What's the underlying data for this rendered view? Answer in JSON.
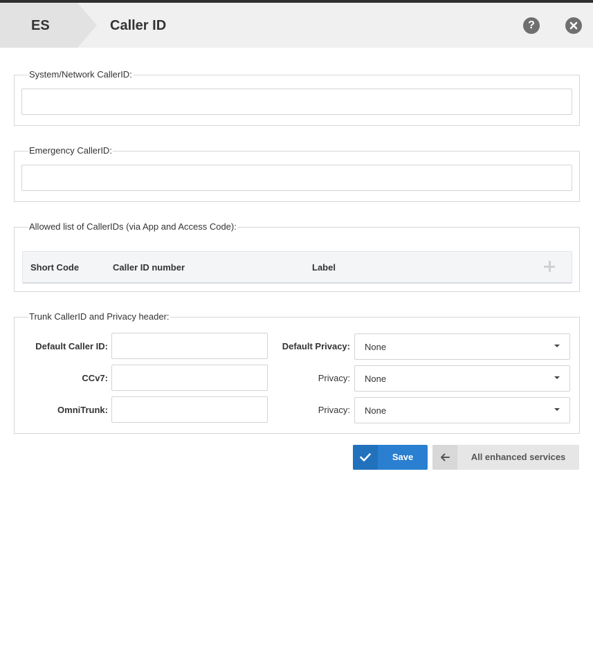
{
  "header": {
    "breadcrumb": "ES",
    "title": "Caller ID"
  },
  "sections": {
    "system_network": {
      "legend": "System/Network CallerID:",
      "value": "",
      "placeholder": ""
    },
    "emergency": {
      "legend": "Emergency CallerID:",
      "value": "",
      "placeholder": ""
    },
    "allowed_list": {
      "legend": "Allowed list of CallerIDs (via App and Access Code):",
      "columns": [
        "Short Code",
        "Caller ID number",
        "Label"
      ],
      "rows": []
    },
    "trunk": {
      "legend": "Trunk CallerID and Privacy header:",
      "rows": [
        {
          "label": "Default Caller ID:",
          "value": "",
          "privacy_label": "Default Privacy:",
          "privacy_value": "None"
        },
        {
          "label": "CCv7:",
          "value": "",
          "privacy_label": "Privacy:",
          "privacy_value": "None"
        },
        {
          "label": "OmniTrunk:",
          "value": "",
          "privacy_label": "Privacy:",
          "privacy_value": "None"
        }
      ]
    }
  },
  "actions": {
    "save_label": "Save",
    "back_label": "All enhanced services"
  },
  "colors": {
    "accent": "#2a7fd0",
    "header_bg": "#f0f0f0",
    "icon_gray": "#6f6f6f"
  },
  "icons": [
    "help-icon",
    "close-icon",
    "plus-icon",
    "check-icon",
    "arrow-left-icon",
    "caret-down-icon"
  ]
}
